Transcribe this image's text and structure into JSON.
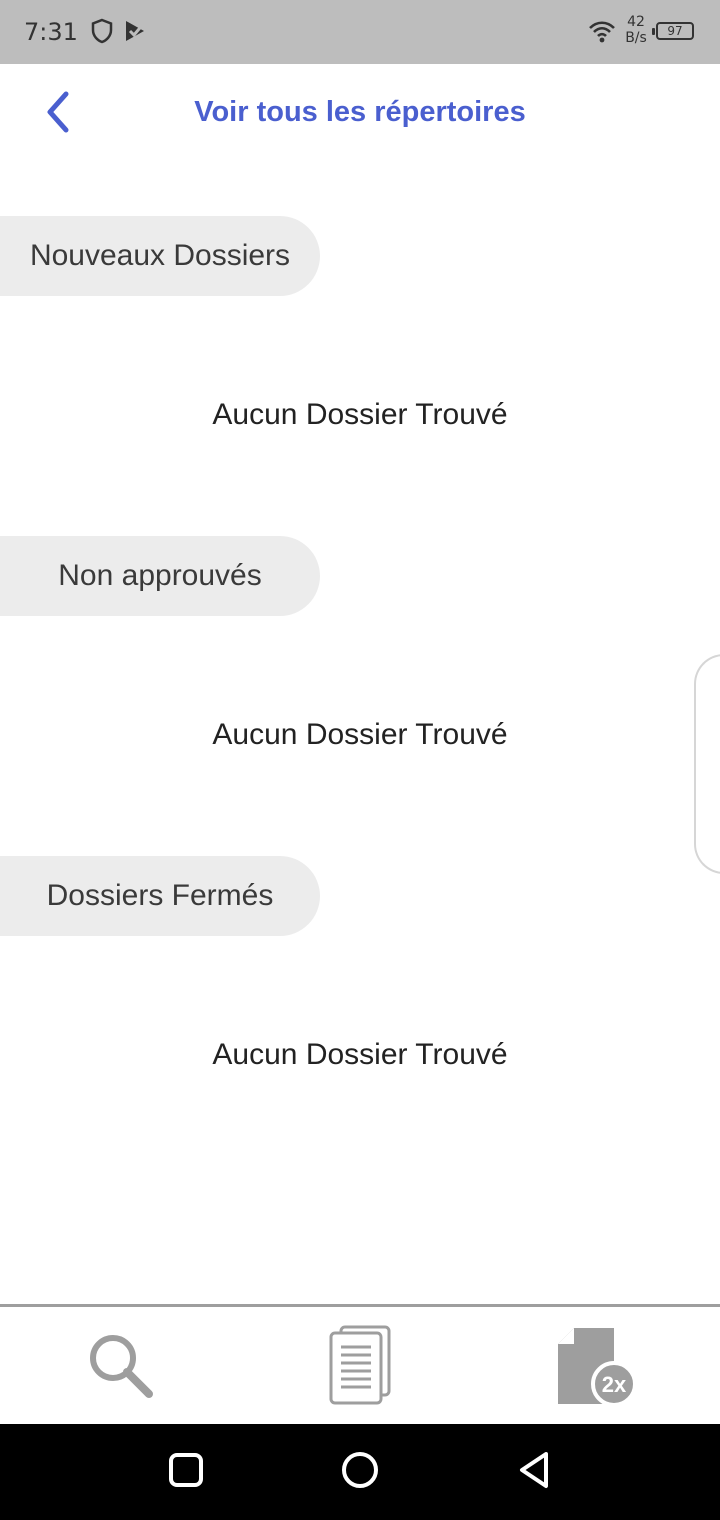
{
  "status_bar": {
    "time": "7:31",
    "net_speed_value": "42",
    "net_speed_unit": "B/s",
    "battery": "97",
    "icons": [
      "shield-icon",
      "play-check-icon",
      "wifi-icon",
      "battery-icon"
    ]
  },
  "header": {
    "title": "Voir tous les répertoires",
    "back_icon": "chevron-left-icon",
    "accent_color": "#4a5fcf"
  },
  "sections": [
    {
      "label": "Nouveaux Dossiers",
      "empty_text": "Aucun Dossier Trouvé"
    },
    {
      "label": "Non approuvés",
      "empty_text": "Aucun Dossier Trouvé"
    },
    {
      "label": "Dossiers Fermés",
      "empty_text": "Aucun Dossier Trouvé"
    }
  ],
  "bottom_nav": {
    "items": [
      {
        "icon": "search-icon"
      },
      {
        "icon": "documents-icon"
      },
      {
        "icon": "file-2x-icon",
        "badge": "2x"
      }
    ]
  },
  "system_nav": {
    "items": [
      "recents-icon",
      "home-icon",
      "back-triangle-icon"
    ]
  }
}
